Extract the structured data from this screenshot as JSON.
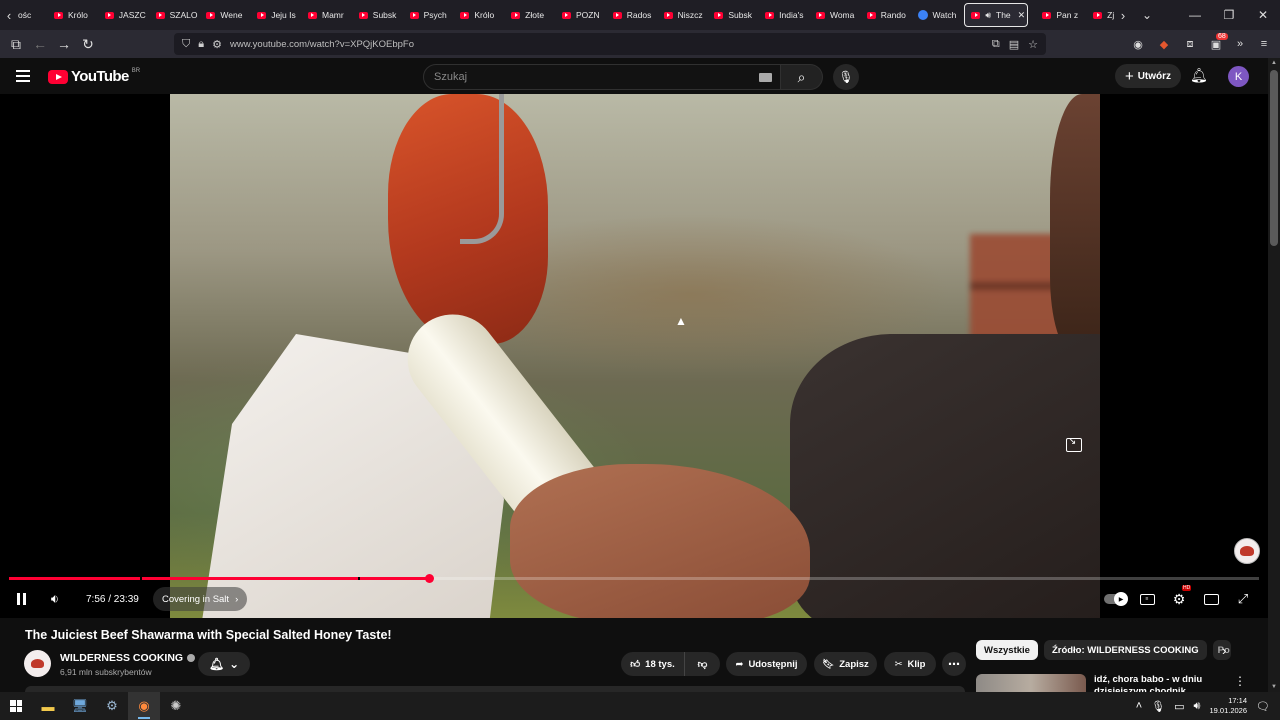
{
  "browser": {
    "tabs": [
      {
        "title": "Królo"
      },
      {
        "title": "JASZC"
      },
      {
        "title": "SZALO"
      },
      {
        "title": "Wene"
      },
      {
        "title": "Jeju Is"
      },
      {
        "title": "Mamr"
      },
      {
        "title": "Subsk"
      },
      {
        "title": "Psych"
      },
      {
        "title": "Królo"
      },
      {
        "title": "Złote"
      },
      {
        "title": "POZN"
      },
      {
        "title": "Rados"
      },
      {
        "title": "Niszcz"
      },
      {
        "title": "Subsk"
      },
      {
        "title": "India's"
      },
      {
        "title": "Woma"
      },
      {
        "title": "Rando"
      },
      {
        "title": "Watch"
      }
    ],
    "first_tab_fragment": "ośc",
    "active_tab": {
      "title": "The"
    },
    "after_tabs": [
      {
        "title": "Pan z"
      },
      {
        "title": "Zjeżdż"
      }
    ],
    "url": "www.youtube.com/watch?v=XPQjKOEbpFo",
    "extension_badge": "68"
  },
  "youtube": {
    "logo_text": "YouTube",
    "country_code": "BR",
    "search_placeholder": "Szukaj",
    "create_label": "Utwórz",
    "avatar_letter": "K"
  },
  "player": {
    "current_time": "7:56",
    "duration": "23:39",
    "time_display": "7:56 / 23:39",
    "chapter": "Covering in Salt",
    "chapter_chevron": "›",
    "progress_fraction": 0.336,
    "buffered_fraction": 0.34,
    "hd_badge": "HD"
  },
  "video": {
    "title": "The Juiciest Beef Shawarma with Special Salted Honey Taste!",
    "channel_name": "WILDERNESS COOKING",
    "subscribers": "6,91 mln subskrybentów",
    "likes": "18 tys.",
    "share_label": "Udostępnij",
    "save_label": "Zapisz",
    "clip_label": "Klip"
  },
  "sidebar": {
    "chips": [
      {
        "label": "Wszystkie"
      },
      {
        "label": "Źródło: WILDERNESS COOKING"
      },
      {
        "label": "Po"
      }
    ],
    "recommendation_title": "idź, chora babo - w dniu dzisiejszym chodnik nieczynny"
  },
  "taskbar": {
    "time": "17:14",
    "date": "19.01.2026"
  },
  "colors": {
    "youtube_red": "#ff0033",
    "background": "#0f0f0f",
    "pill_bg": "#272727",
    "avatar_purple": "#7e57c2"
  }
}
